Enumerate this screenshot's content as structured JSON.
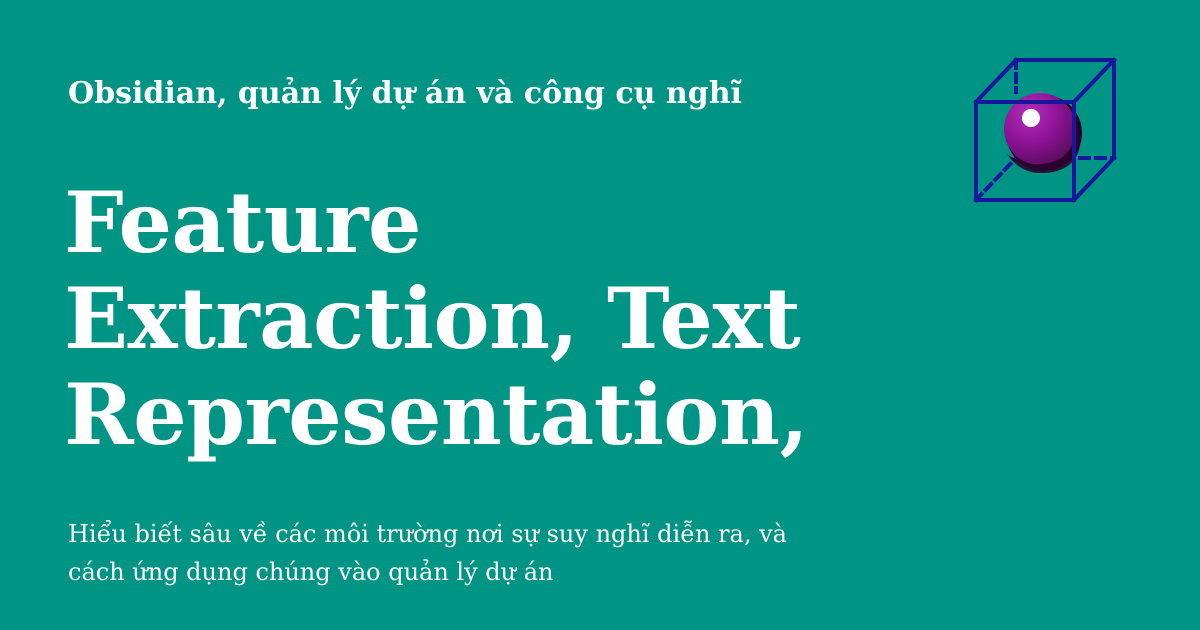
{
  "site": {
    "name": "Obsidian, quản lý dự án và công cụ nghĩ"
  },
  "post": {
    "title_lines": [
      "Feature",
      "Extraction, Text",
      "Representation,"
    ],
    "description_lines": [
      "Hiểu biết sâu về các môi trường nơi sự suy nghĩ diễn ra, và",
      "cách ứng dụng chúng vào quản lý dự án"
    ]
  },
  "logo": {
    "icon_name": "cube-with-sphere-icon",
    "background_color": "#009485",
    "cube_color": "#16179a",
    "sphere_color": "#8e1296",
    "sphere_shadow_color": "#2a002d",
    "highlight_color": "#ffffff"
  },
  "colors": {
    "background": "#009485",
    "text": "#ffffff"
  }
}
